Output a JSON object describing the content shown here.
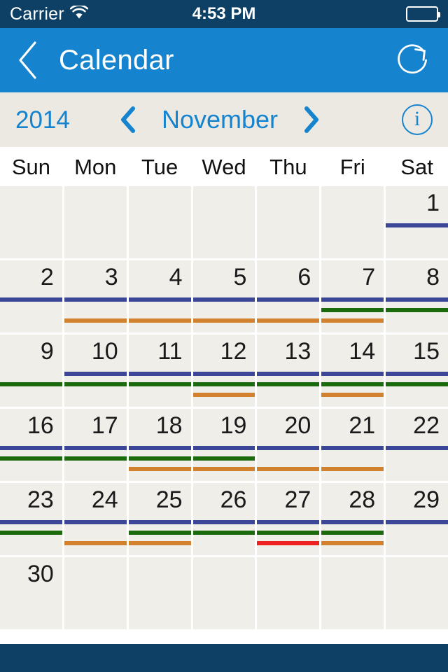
{
  "status_bar": {
    "carrier": "Carrier",
    "wifi_icon": "wifi-icon",
    "time": "4:53 PM",
    "battery_icon": "battery-full-icon",
    "background_color": "#0E4065"
  },
  "nav_bar": {
    "back_icon": "chevron-left-icon",
    "title": "Calendar",
    "refresh_icon": "refresh-icon",
    "background_color": "#1683CE"
  },
  "month_bar": {
    "year": "2014",
    "prev_icon": "chevron-left-icon",
    "month": "November",
    "next_icon": "chevron-right-icon",
    "info_icon": "info-icon",
    "info_glyph": "i",
    "background_color": "#ECE9E3",
    "accent_color": "#1683CE"
  },
  "weekdays": [
    "Sun",
    "Mon",
    "Tue",
    "Wed",
    "Thu",
    "Fri",
    "Sat"
  ],
  "event_colors": {
    "blue": "#3B4696",
    "green": "#1B6B0E",
    "orange": "#D2822F",
    "red": "#EE2222"
  },
  "calendar": {
    "cell_background": "#EFEEE9",
    "weeks": [
      [
        {
          "day": "",
          "bars": []
        },
        {
          "day": "",
          "bars": []
        },
        {
          "day": "",
          "bars": []
        },
        {
          "day": "",
          "bars": []
        },
        {
          "day": "",
          "bars": []
        },
        {
          "day": "",
          "bars": []
        },
        {
          "day": "1",
          "bars": [
            "blue"
          ]
        }
      ],
      [
        {
          "day": "2",
          "bars": [
            "blue"
          ]
        },
        {
          "day": "3",
          "bars": [
            "blue",
            "spacer",
            "orange"
          ]
        },
        {
          "day": "4",
          "bars": [
            "blue",
            "spacer",
            "orange"
          ]
        },
        {
          "day": "5",
          "bars": [
            "blue",
            "spacer",
            "orange"
          ]
        },
        {
          "day": "6",
          "bars": [
            "blue",
            "spacer",
            "orange"
          ]
        },
        {
          "day": "7",
          "bars": [
            "blue",
            "green",
            "orange"
          ]
        },
        {
          "day": "8",
          "bars": [
            "blue",
            "green"
          ]
        }
      ],
      [
        {
          "day": "9",
          "bars": [
            "spacer",
            "green"
          ]
        },
        {
          "day": "10",
          "bars": [
            "blue",
            "green"
          ]
        },
        {
          "day": "11",
          "bars": [
            "blue",
            "green"
          ]
        },
        {
          "day": "12",
          "bars": [
            "blue",
            "green",
            "orange"
          ]
        },
        {
          "day": "13",
          "bars": [
            "blue",
            "green"
          ]
        },
        {
          "day": "14",
          "bars": [
            "blue",
            "green",
            "orange"
          ]
        },
        {
          "day": "15",
          "bars": [
            "blue",
            "green"
          ]
        }
      ],
      [
        {
          "day": "16",
          "bars": [
            "blue",
            "green"
          ]
        },
        {
          "day": "17",
          "bars": [
            "blue",
            "green"
          ]
        },
        {
          "day": "18",
          "bars": [
            "blue",
            "green",
            "orange"
          ]
        },
        {
          "day": "19",
          "bars": [
            "blue",
            "green",
            "orange"
          ]
        },
        {
          "day": "20",
          "bars": [
            "blue",
            "spacer",
            "orange"
          ]
        },
        {
          "day": "21",
          "bars": [
            "blue",
            "spacer",
            "orange"
          ]
        },
        {
          "day": "22",
          "bars": [
            "blue"
          ]
        }
      ],
      [
        {
          "day": "23",
          "bars": [
            "blue",
            "green"
          ]
        },
        {
          "day": "24",
          "bars": [
            "blue",
            "spacer",
            "orange"
          ]
        },
        {
          "day": "25",
          "bars": [
            "blue",
            "green",
            "orange"
          ]
        },
        {
          "day": "26",
          "bars": [
            "blue",
            "green"
          ]
        },
        {
          "day": "27",
          "bars": [
            "blue",
            "green",
            "red"
          ]
        },
        {
          "day": "28",
          "bars": [
            "blue",
            "green",
            "orange"
          ]
        },
        {
          "day": "29",
          "bars": [
            "blue"
          ]
        }
      ],
      [
        {
          "day": "30",
          "bars": []
        },
        {
          "day": "",
          "bars": []
        },
        {
          "day": "",
          "bars": []
        },
        {
          "day": "",
          "bars": []
        },
        {
          "day": "",
          "bars": []
        },
        {
          "day": "",
          "bars": []
        },
        {
          "day": "",
          "bars": []
        }
      ]
    ]
  },
  "bottom_bar": {
    "background_color": "#0E4065"
  }
}
